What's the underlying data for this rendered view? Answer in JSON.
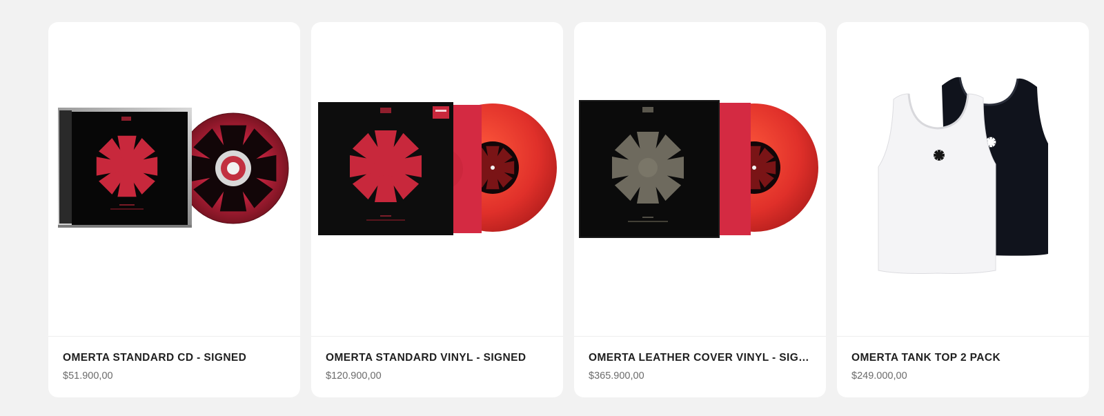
{
  "products": [
    {
      "title": "OMERTA STANDARD CD - SIGNED",
      "price": "$51.900,00",
      "image": "cd-jewel-case-with-red-disc"
    },
    {
      "title": "OMERTA STANDARD VINYL - SIGNED",
      "price": "$120.900,00",
      "image": "black-sleeve-red-vinyl"
    },
    {
      "title": "OMERTA LEATHER COVER VINYL - SIGNED",
      "price": "$365.900,00",
      "image": "black-leather-sleeve-red-vinyl"
    },
    {
      "title": "OMERTA TANK TOP 2 PACK",
      "price": "$249.000,00",
      "image": "white-and-black-tank-tops"
    }
  ],
  "colors": {
    "page_bg": "#f2f2f2",
    "card_bg": "#ffffff",
    "emblem_red": "#c8283c",
    "vinyl_red": "#e0402e",
    "sleeve_black": "#0d0d0d",
    "emblem_grey": "#6e6a5e"
  }
}
